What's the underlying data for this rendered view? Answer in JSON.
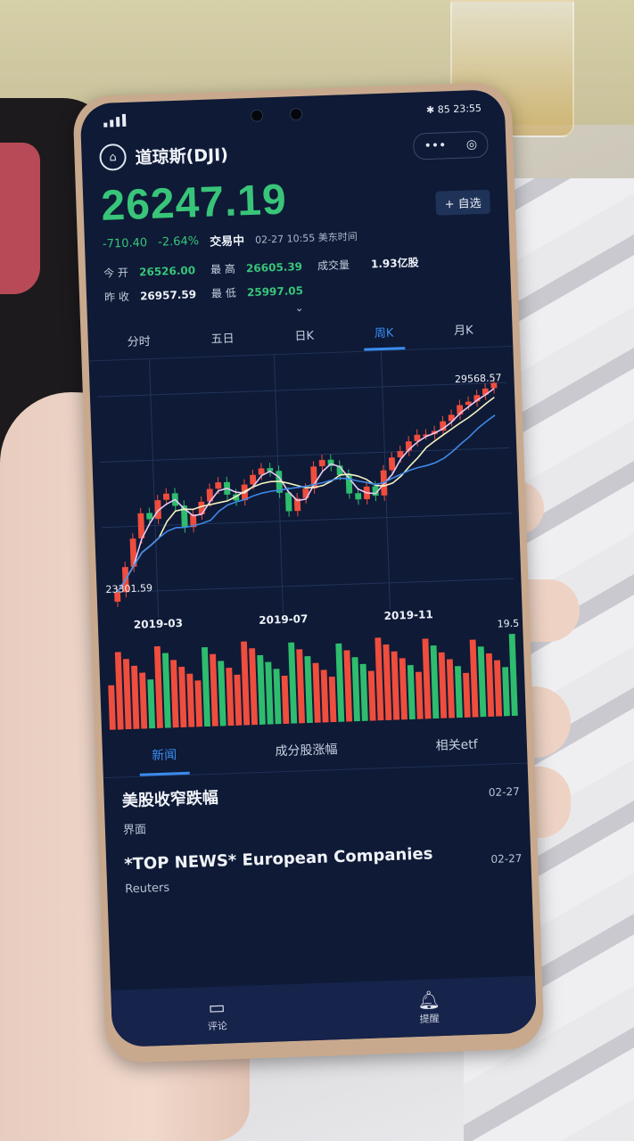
{
  "status": {
    "time": "23:55",
    "battery": "85",
    "network": "4G"
  },
  "header": {
    "title": "道琼斯(DJI)",
    "capsule_more": "•••",
    "capsule_close": "◎",
    "home_icon": "home-icon"
  },
  "quote": {
    "price": "26247.19",
    "change": "-710.40",
    "change_pct": "-2.64%",
    "status": "交易中",
    "timestamp": "02-27 10:55 美东时间",
    "watch_button": "+ 自选",
    "open_label": "今  开",
    "open": "26526.00",
    "prev_close_label": "昨  收",
    "prev_close": "26957.59",
    "high_label": "最  高",
    "high": "26605.39",
    "low_label": "最  低",
    "low": "25997.05",
    "volume_label": "成交量",
    "volume": "1.93亿股"
  },
  "chart_tabs": [
    "分时",
    "五日",
    "日K",
    "周K",
    "月K"
  ],
  "chart": {
    "max_label": "29568.57",
    "min_label": "23301.59",
    "volume_max_label": "19.5",
    "dates": [
      "2019-03",
      "2019-07",
      "2019-11"
    ]
  },
  "chart_data": {
    "type": "candlestick",
    "xlim_labels": [
      "2019-03",
      "2019-07",
      "2019-11"
    ],
    "ylim": [
      23301.59,
      29568.57
    ],
    "close": [
      23301.59,
      24100,
      25000,
      25800,
      25600,
      26200,
      26400,
      26000,
      25300,
      25700,
      26100,
      26500,
      26700,
      26300,
      26100,
      26600,
      26900,
      27100,
      27000,
      26300,
      25700,
      26100,
      26400,
      27100,
      27300,
      27100,
      26800,
      26200,
      26000,
      26400,
      26100,
      26900,
      27300,
      27500,
      27800,
      28000,
      28000,
      28100,
      28400,
      28600,
      28900,
      29000,
      29200,
      29400,
      29568.57
    ],
    "volume_colors": [
      "red",
      "red",
      "red",
      "red",
      "red",
      "green",
      "red",
      "green",
      "red",
      "red",
      "red",
      "red",
      "green",
      "red",
      "green",
      "red",
      "red",
      "red",
      "red",
      "green",
      "green",
      "green",
      "red",
      "green",
      "red",
      "green",
      "red",
      "red",
      "red",
      "green",
      "red",
      "green",
      "green",
      "red",
      "red",
      "red",
      "red",
      "red",
      "green",
      "red",
      "red",
      "green",
      "red",
      "red",
      "green",
      "red",
      "red",
      "green",
      "red",
      "red",
      "green",
      "green"
    ],
    "colors": {
      "up": "#ef4d3d",
      "down": "#2ebd6e",
      "ma5": "#e8c9f4",
      "ma10": "#f4f1c2",
      "ma20": "#3f88e6"
    }
  },
  "news_tabs": [
    "新闻",
    "成分股涨幅",
    "相关etf"
  ],
  "news": [
    {
      "title": "美股收窄跌幅",
      "source": "界面",
      "date": "02-27"
    },
    {
      "title": "*TOP NEWS* European Companies",
      "source": "Reuters",
      "date": "02-27"
    }
  ],
  "footer": {
    "comment_label": "评论",
    "remind_label": "提醒"
  }
}
